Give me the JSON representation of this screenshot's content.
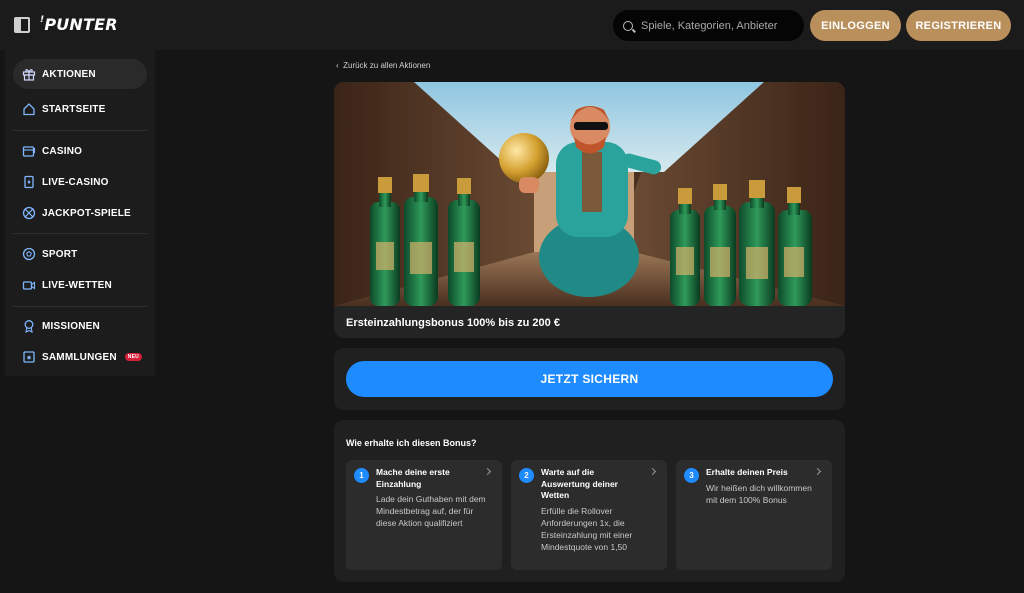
{
  "header": {
    "logo": "PUNTER",
    "search_placeholder": "Spiele, Kategorien, Anbieter",
    "login_label": "EINLOGGEN",
    "register_label": "REGISTRIEREN"
  },
  "sidebar": {
    "items": [
      {
        "label": "AKTIONEN",
        "icon": "gift-icon",
        "active": true
      },
      {
        "label": "STARTSEITE",
        "icon": "home-icon"
      },
      {
        "label": "CASINO",
        "icon": "slot-machine-icon"
      },
      {
        "label": "LIVE-CASINO",
        "icon": "card-icon"
      },
      {
        "label": "JACKPOT-SPIELE",
        "icon": "jackpot-icon"
      },
      {
        "label": "SPORT",
        "icon": "soccer-ball-icon"
      },
      {
        "label": "LIVE-WETTEN",
        "icon": "video-icon"
      },
      {
        "label": "MISSIONEN",
        "icon": "medal-icon"
      },
      {
        "label": "SAMMLUNGEN",
        "icon": "collection-icon",
        "badge": "NEU"
      }
    ]
  },
  "main": {
    "back_link": "Zurück zu allen Aktionen",
    "promo_title": "Ersteinzahlungsbonus 100% bis zu 200 €",
    "cta_label": "JETZT SICHERN",
    "steps_title": "Wie erhalte ich diesen Bonus?",
    "steps": [
      {
        "num": "1",
        "title": "Mache deine erste Einzahlung",
        "body": "Lade dein Guthaben mit dem Mindestbetrag auf, der für diese Aktion qualifiziert"
      },
      {
        "num": "2",
        "title": "Warte auf die Auswertung deiner Wetten",
        "body": "Erfülle die Rollover Anforderungen 1x, die Ersteinzahlung mit einer Mindestquote von 1,50"
      },
      {
        "num": "3",
        "title": "Erhalte deinen Preis",
        "body": "Wir heißen dich willkommen mit dem 100% Bonus"
      }
    ]
  },
  "colors": {
    "accent_blue": "#1e8bff",
    "gold": "#b98f5c",
    "badge_red": "#d61f3a"
  }
}
